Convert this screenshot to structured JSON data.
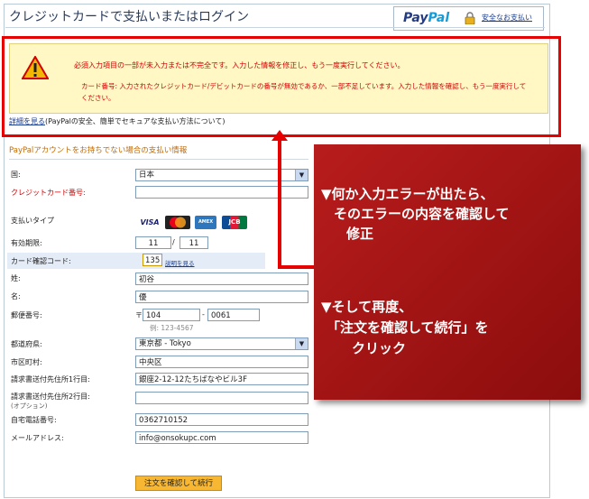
{
  "header": {
    "title": "クレジットカードで支払いまたはログイン",
    "paypal_pay": "Pay",
    "paypal_pal": "Pal",
    "secure_link": "安全なお支払い"
  },
  "error": {
    "main": "必須入力項目の一部が未入力または不完全です。入力した情報を修正し、もう一度実行してください。",
    "sub": "カード番号: 入力されたクレジットカード/デビットカードの番号が無効であるか、一部不足しています。入力した情報を確認し、もう一度実行してください。"
  },
  "details": {
    "link": "詳細を見る",
    "text": "(PayPalの安全、簡単でセキュアな支払い方法について)"
  },
  "form": {
    "title": "PayPalアカウントをお持ちでない場合の支払い情報",
    "country_label": "国:",
    "country_value": "日本",
    "card_number_label": "クレジットカード番号:",
    "card_number_value": "",
    "payment_type_label": "支払いタイプ",
    "cards": [
      "VISA",
      "MasterCard",
      "AMEX",
      "JCB"
    ],
    "expiry_label": "有効期限:",
    "expiry_month": "11",
    "expiry_sep": "/",
    "expiry_year": "11",
    "cvc_label": "カード確認コード:",
    "cvc_value": "135",
    "cvc_link": "説明を見る",
    "last_name_label": "姓:",
    "last_name_value": "初谷",
    "first_name_label": "名:",
    "first_name_value": "優",
    "postal_label": "郵便番号:",
    "postal_mark": "〒",
    "postal1": "104",
    "postal_dash": "-",
    "postal2": "0061",
    "postal_hint": "例: 123-4567",
    "prefecture_label": "都道府県:",
    "prefecture_value": "東京都 - Tokyo",
    "city_label": "市区町村:",
    "city_value": "中央区",
    "address1_label": "請求書送付先住所1行目:",
    "address1_value": "銀座2-12-12たちばなやビル3F",
    "address2_label": "請求書送付先住所2行目:",
    "address2_optional": "(オプション)",
    "address2_value": "",
    "phone_label": "自宅電話番号:",
    "phone_value": "0362710152",
    "email_label": "メールアドレス:",
    "email_value": "info@onsokupc.com",
    "submit_label": "注文を確認して続行"
  },
  "callout": {
    "line1": "▼何か入力エラーが出たら、",
    "line2": "そのエラーの内容を確認して",
    "line3": "修正",
    "line4": "▼そして再度、",
    "line5": "「注文を確認して続行」を",
    "line6": "クリック"
  },
  "colors": {
    "error_red": "#e60000",
    "callout_red": "#a51616",
    "submit_orange": "#f7b733",
    "error_bg": "#fff8c4"
  }
}
